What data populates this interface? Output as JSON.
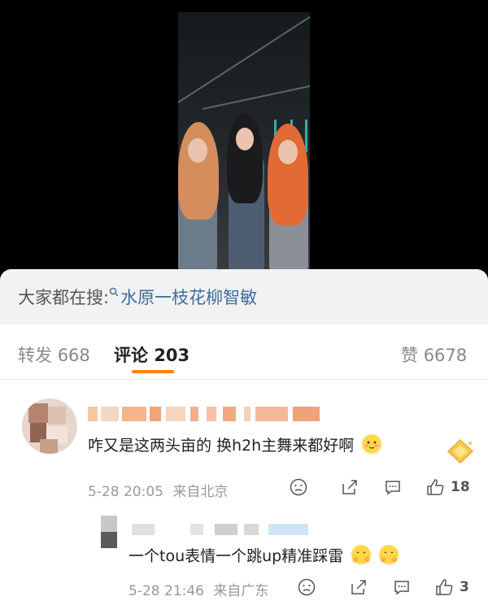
{
  "search": {
    "prefix": "大家都在搜: ",
    "query": "水原一枝花柳智敏",
    "icon": "search-icon"
  },
  "tabs": {
    "repost_label": "转发",
    "repost_count": "668",
    "comment_label": "评论",
    "comment_count": "203",
    "like_label": "赞",
    "like_count": "6678",
    "accent": "#ff8200"
  },
  "comments": [
    {
      "text": "咋又是这两头亩的 换h2h主舞来都好啊",
      "time": "5-28 20:05",
      "location": "来自北京",
      "like_count": "18"
    },
    {
      "text": "一个tou表情一个跳up精准踩雷",
      "time": "5-28 21:46",
      "location": "来自广东",
      "like_count": "3"
    }
  ]
}
